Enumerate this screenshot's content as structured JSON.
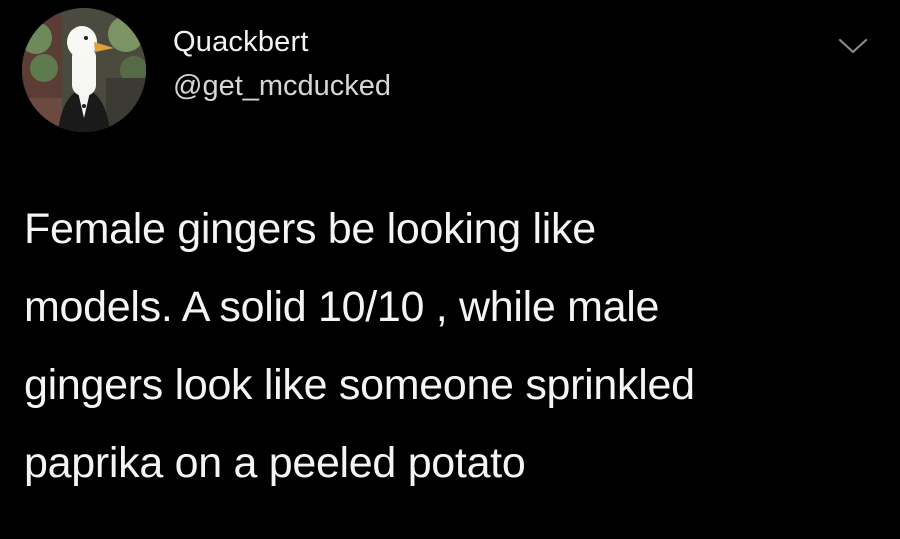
{
  "tweet": {
    "author": {
      "display_name": "Quackbert",
      "handle": "@get_mcducked",
      "avatar_icon": "duck-in-suit-avatar"
    },
    "menu_icon": "chevron-down-icon",
    "text_lines": [
      "Female gingers be looking like",
      "models. A solid 10/10 , while male",
      "gingers look like someone sprinkled",
      "paprika on a peeled potato"
    ]
  },
  "colors": {
    "background": "#000000",
    "text": "#f4f4f4",
    "handle": "#d6d6d6",
    "chevron": "#8a8a8a"
  }
}
